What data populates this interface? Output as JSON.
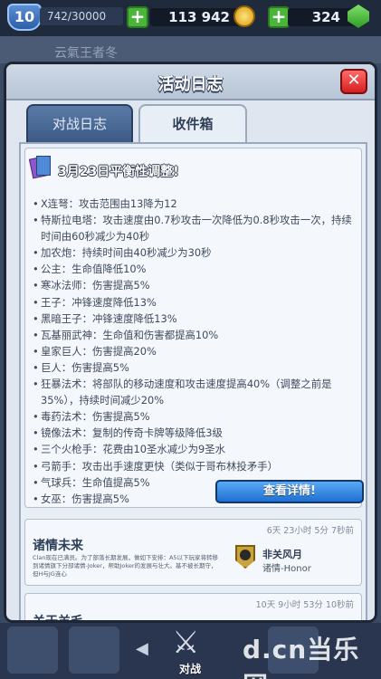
{
  "topbar": {
    "level": "10",
    "xp": "742/30000",
    "gold": "113 942",
    "gems": "324",
    "plus_symbol": "+"
  },
  "background_title": "云氣王者冬",
  "modal": {
    "title": "活动日志",
    "close_symbol": "✕",
    "tabs": [
      {
        "label": "对战日志",
        "active": false
      },
      {
        "label": "收件箱",
        "active": true
      }
    ]
  },
  "messages": [
    {
      "title": "3月23日平衡性调整!",
      "notes": [
        "X连弩：攻击范围由13降为12",
        "特斯拉电塔：攻击速度由0.7秒攻击一次降低为0.8秒攻击一次，持续时间由60秒减少为40秒",
        "加农炮：持续时间由40秒减少为30秒",
        "公主：生命值降低10%",
        "寒冰法师：伤害提高5%",
        "王子：冲锋速度降低13%",
        "黑暗王子：冲锋速度降低13%",
        "瓦基丽武神：生命值和伤害都提高10%",
        "皇家巨人：伤害提高20%",
        "巨人：伤害提高5%",
        "狂暴法术：将部队的移动速度和攻击速度提高40%（调整之前是35%），持续时间减少20%",
        "毒药法术：伤害提高5%",
        "镜像法术：复制的传奇卡牌等级降低3级",
        "三个火枪手：花费由10圣水减少为9圣水",
        "弓箭手：攻击出手速度更快（类似于哥布林投矛手）",
        "气球兵：生命值提高5%",
        "女巫：伤害提高5%"
      ],
      "button_label": "查看详情!"
    },
    {
      "time": "6天 23小时 5分 7秒前",
      "title": "诸情未来",
      "body": "Clan现在已满员。为了部落长期发展，做如下安排：A5以下玩家将转移到诸情旗下分部诸情-Joker，帮助Joker的发展与壮大。基不被长期守，但H与JG连心",
      "sender_name": "非关风月",
      "sender_rank": "诸情-Honor"
    },
    {
      "time": "10天 9小时 53分 10秒前",
      "title": "关于羊毛"
    }
  ],
  "bottom_nav": {
    "battle_label": "对战",
    "watermark": "d.cn当乐网",
    "arrow": "◀"
  },
  "colors": {
    "accent_blue": "#1f6fd1",
    "close_red": "#d42020",
    "gold": "#d79a12",
    "gem_green": "#2e9c23"
  }
}
